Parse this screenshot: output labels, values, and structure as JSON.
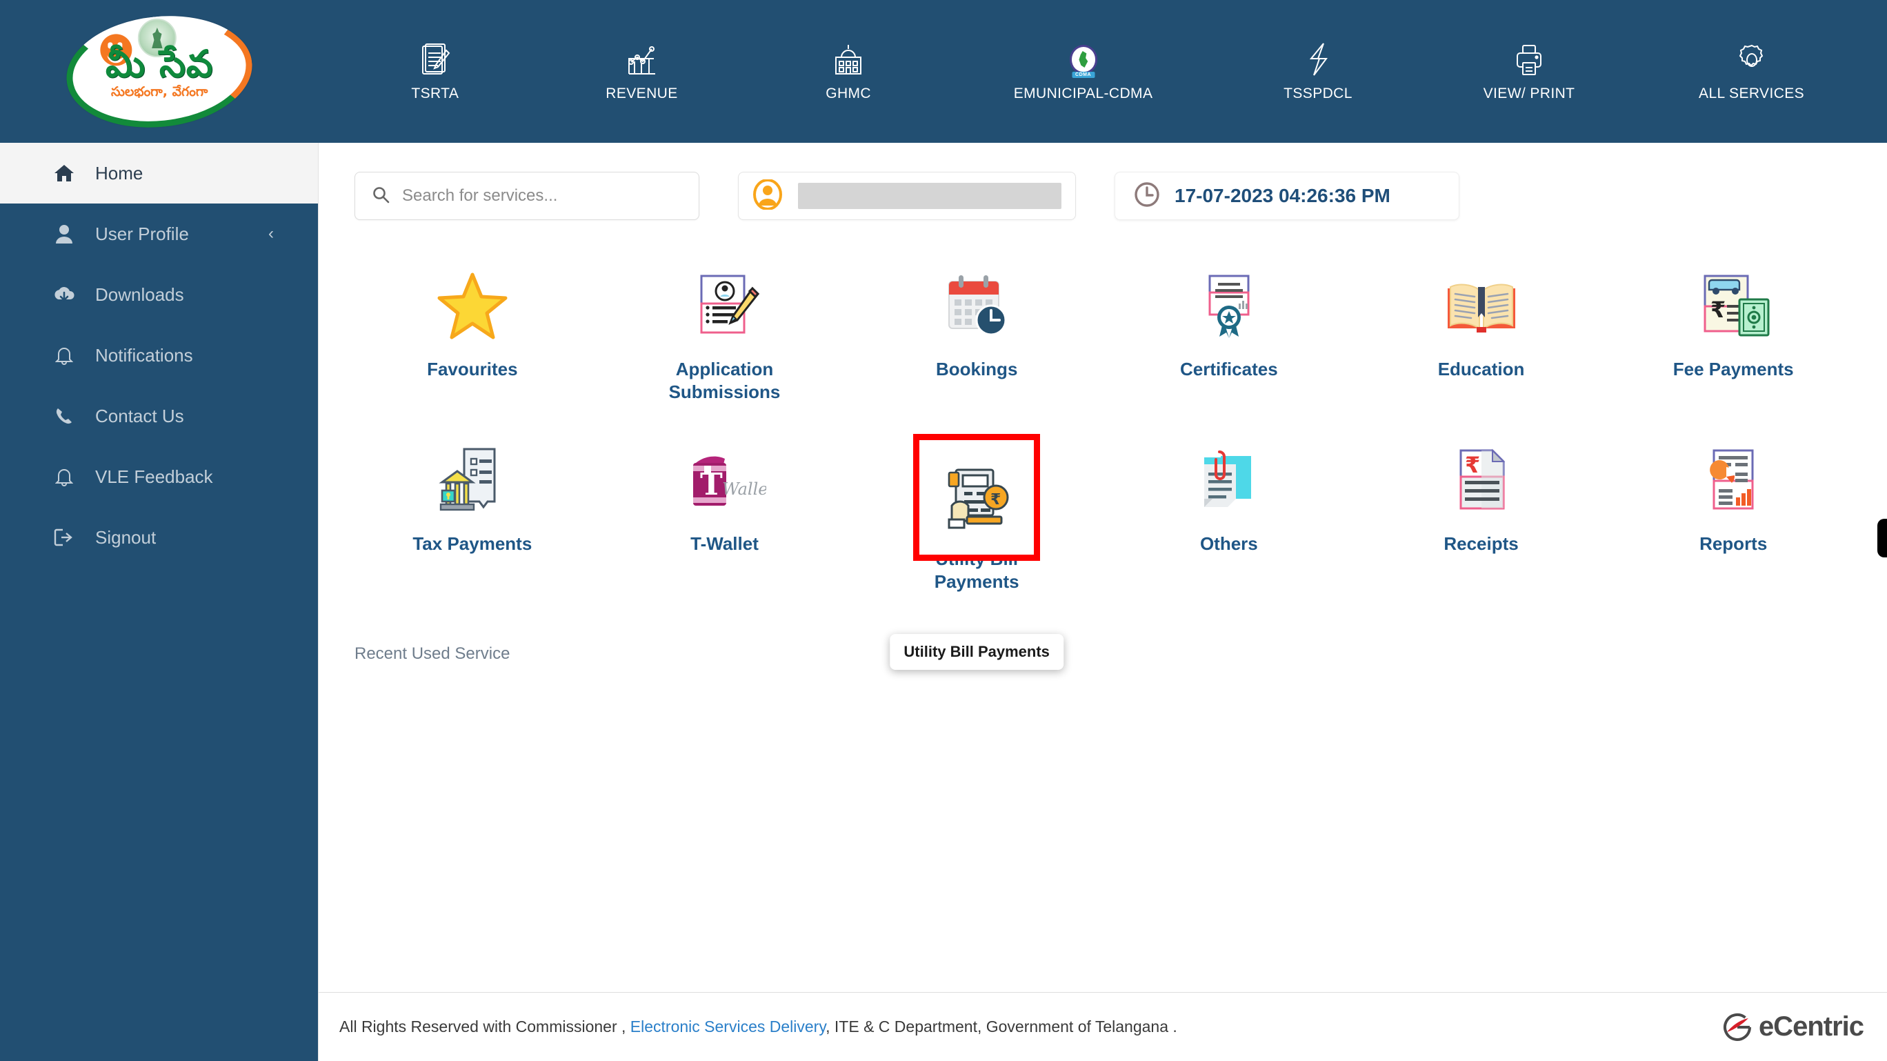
{
  "brand": {
    "logo_primary_text": "మీ సేవ",
    "logo_tagline": "సులభంగా, వేగంగా",
    "logo_alt": "mee-seva-logo"
  },
  "topnav": {
    "items": [
      {
        "label": "TSRTA",
        "icon": "document-pencil-icon"
      },
      {
        "label": "REVENUE",
        "icon": "chart-growth-icon"
      },
      {
        "label": "GHMC",
        "icon": "government-building-icon"
      },
      {
        "label": "EMUNICIPAL-CDMA",
        "icon": "cdma-emblem-icon",
        "ribbon": "CDMA"
      },
      {
        "label": "TSSPDCL",
        "icon": "lightning-bolt-icon"
      },
      {
        "label": "VIEW/ PRINT",
        "icon": "printer-icon"
      },
      {
        "label": "ALL SERVICES",
        "icon": "gear-icon"
      }
    ]
  },
  "sidebar": {
    "items": [
      {
        "label": "Home",
        "icon": "home-icon",
        "active": true,
        "chevron": ""
      },
      {
        "label": "User Profile",
        "icon": "user-icon",
        "active": false,
        "chevron": "‹"
      },
      {
        "label": "Downloads",
        "icon": "cloud-download-icon",
        "active": false,
        "chevron": ""
      },
      {
        "label": "Notifications",
        "icon": "bell-icon",
        "active": false,
        "chevron": ""
      },
      {
        "label": "Contact Us",
        "icon": "phone-icon",
        "active": false,
        "chevron": ""
      },
      {
        "label": "VLE Feedback",
        "icon": "bell-outline-icon",
        "active": false,
        "chevron": ""
      },
      {
        "label": "Signout",
        "icon": "signout-icon",
        "active": false,
        "chevron": ""
      }
    ]
  },
  "toolbar": {
    "search_placeholder": "Search for services...",
    "search_value": "",
    "search_icon": "search-icon",
    "user_icon": "user-avatar-icon",
    "user_name_redacted": "",
    "clock_icon": "clock-icon",
    "datetime": "17-07-2023 04:26:36 PM"
  },
  "tiles": {
    "row1": [
      {
        "label": "Favourites",
        "icon": "star-icon"
      },
      {
        "label": "Application Submissions",
        "icon": "application-form-icon"
      },
      {
        "label": "Bookings",
        "icon": "calendar-clock-icon"
      },
      {
        "label": "Certificates",
        "icon": "certificate-icon"
      },
      {
        "label": "Education",
        "icon": "open-book-icon"
      },
      {
        "label": "Fee Payments",
        "icon": "fee-payment-icon"
      }
    ],
    "row2": [
      {
        "label": "Tax Payments",
        "icon": "tax-bank-icon"
      },
      {
        "label": "T-Wallet",
        "icon": "t-wallet-icon"
      },
      {
        "label": "Utility Bill Payments",
        "icon": "utility-bill-icon",
        "highlighted": true
      },
      {
        "label": "Others",
        "icon": "paperclip-document-icon"
      },
      {
        "label": "Receipts",
        "icon": "receipt-icon"
      },
      {
        "label": "Reports",
        "icon": "report-chart-icon"
      }
    ]
  },
  "tooltip": {
    "text": "Utility Bill Payments"
  },
  "recent": {
    "label": "Recent Used Service"
  },
  "footer": {
    "text_before": "All Rights Reserved with Commissioner , ",
    "link_text": "Electronic Services Delivery",
    "text_after": ", ITE & C Department, Government of Telangana .",
    "vendor_name": "eCentric",
    "vendor_icon": "ecentric-logo-icon"
  },
  "colors": {
    "navy": "#224f72",
    "accent_orange": "#f9a51a",
    "highlight_red": "#ff0000",
    "link_blue": "#2a7fc9",
    "tile_label": "#1f5686"
  }
}
